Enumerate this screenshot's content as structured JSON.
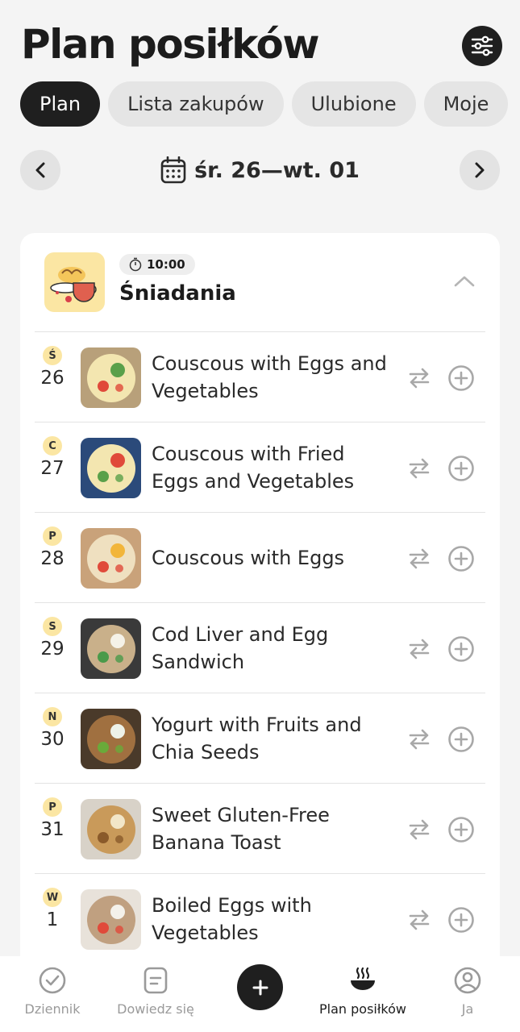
{
  "header": {
    "title": "Plan posiłków",
    "filter_icon": "sliders-icon"
  },
  "tabs": [
    {
      "label": "Plan",
      "active": true
    },
    {
      "label": "Lista zakupów",
      "active": false
    },
    {
      "label": "Ulubione",
      "active": false
    },
    {
      "label": "Moje",
      "active": false
    }
  ],
  "date_nav": {
    "range": "śr. 26—wt. 01"
  },
  "meal": {
    "time": "10:00",
    "name": "Śniadania"
  },
  "rows": [
    {
      "day_letter": "Ś",
      "day_num": "26",
      "name": "Couscous with Eggs and Vegetables"
    },
    {
      "day_letter": "C",
      "day_num": "27",
      "name": "Couscous with Fried Eggs and Vegetables"
    },
    {
      "day_letter": "P",
      "day_num": "28",
      "name": "Couscous with Eggs"
    },
    {
      "day_letter": "S",
      "day_num": "29",
      "name": "Cod Liver and Egg Sandwich"
    },
    {
      "day_letter": "N",
      "day_num": "30",
      "name": "Yogurt with Fruits and Chia Seeds"
    },
    {
      "day_letter": "P",
      "day_num": "31",
      "name": "Sweet Gluten-Free Banana Toast"
    },
    {
      "day_letter": "W",
      "day_num": "1",
      "name": "Boiled Eggs with Vegetables"
    }
  ],
  "bottom_nav": {
    "diary": "Dziennik",
    "learn": "Dowiedz się",
    "plan": "Plan posiłków",
    "me": "Ja"
  },
  "colors": {
    "accent_yellow": "#fbe6a3",
    "dark": "#1f1f1f"
  }
}
